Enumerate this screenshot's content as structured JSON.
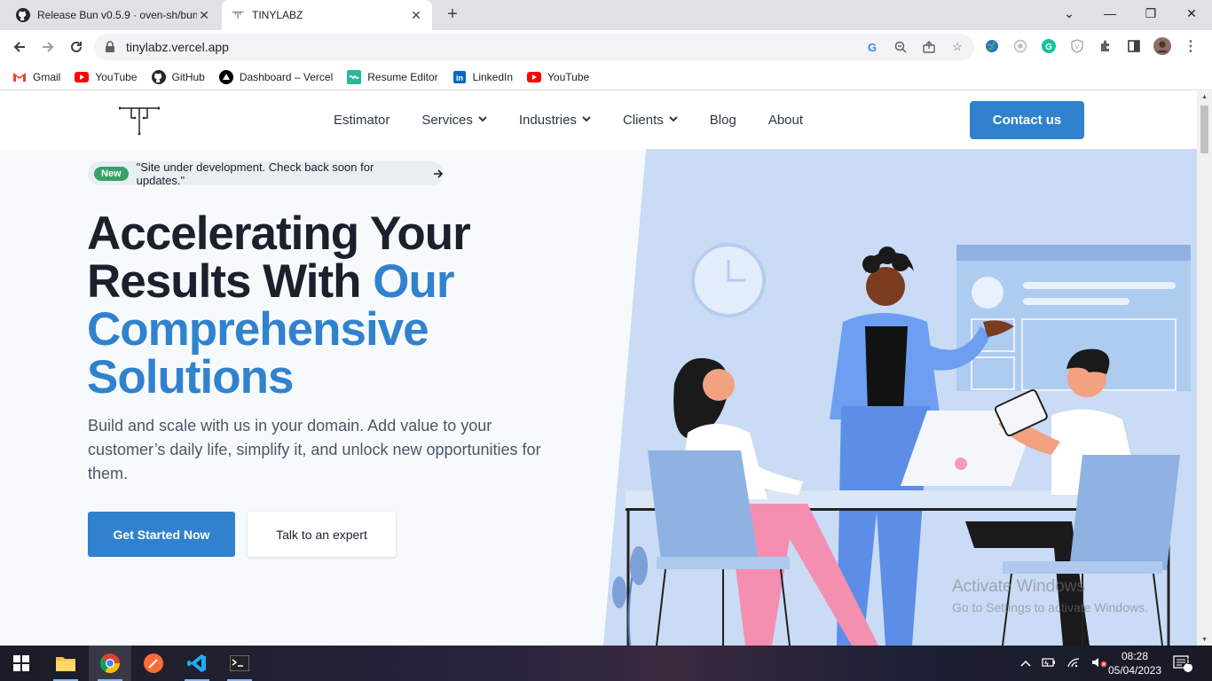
{
  "browser": {
    "tabs": [
      {
        "title": "Release Bun v0.5.9 · oven-sh/bun",
        "icon": "github-icon",
        "active": false
      },
      {
        "title": "TINYLABZ",
        "icon": "tinylabz-icon",
        "active": true
      }
    ],
    "url": "tinylabz.vercel.app",
    "bookmarks": [
      {
        "label": "Gmail",
        "icon": "gmail-icon"
      },
      {
        "label": "YouTube",
        "icon": "youtube-icon"
      },
      {
        "label": "GitHub",
        "icon": "github-icon"
      },
      {
        "label": "Dashboard – Vercel",
        "icon": "vercel-icon"
      },
      {
        "label": "Resume Editor",
        "icon": "resume-editor-icon"
      },
      {
        "label": "LinkedIn",
        "icon": "linkedin-icon"
      },
      {
        "label": "YouTube",
        "icon": "youtube-icon"
      }
    ]
  },
  "site": {
    "nav": {
      "estimator": "Estimator",
      "services": "Services",
      "industries": "Industries",
      "clients": "Clients",
      "blog": "Blog",
      "about": "About",
      "contact": "Contact us"
    },
    "announcement": {
      "badge": "New",
      "text": "\"Site under development. Check back soon for updates.\""
    },
    "hero": {
      "title_part1": "Accelerating Your Results With ",
      "title_accent": "Our Comprehensive Solutions",
      "subtitle": "Build and scale with us in your domain. Add value to your customer’s daily life, simplify it, and unlock new opportunities for them.",
      "cta_primary": "Get Started Now",
      "cta_secondary": "Talk to an expert"
    },
    "colors": {
      "accent": "#3182ce",
      "heading": "#1a202c",
      "badge": "#38a169"
    }
  },
  "os": {
    "watermark_title": "Activate Windows",
    "watermark_sub": "Go to Settings to activate Windows.",
    "time": "08:28",
    "date": "05/04/2023",
    "notifications": "1"
  }
}
